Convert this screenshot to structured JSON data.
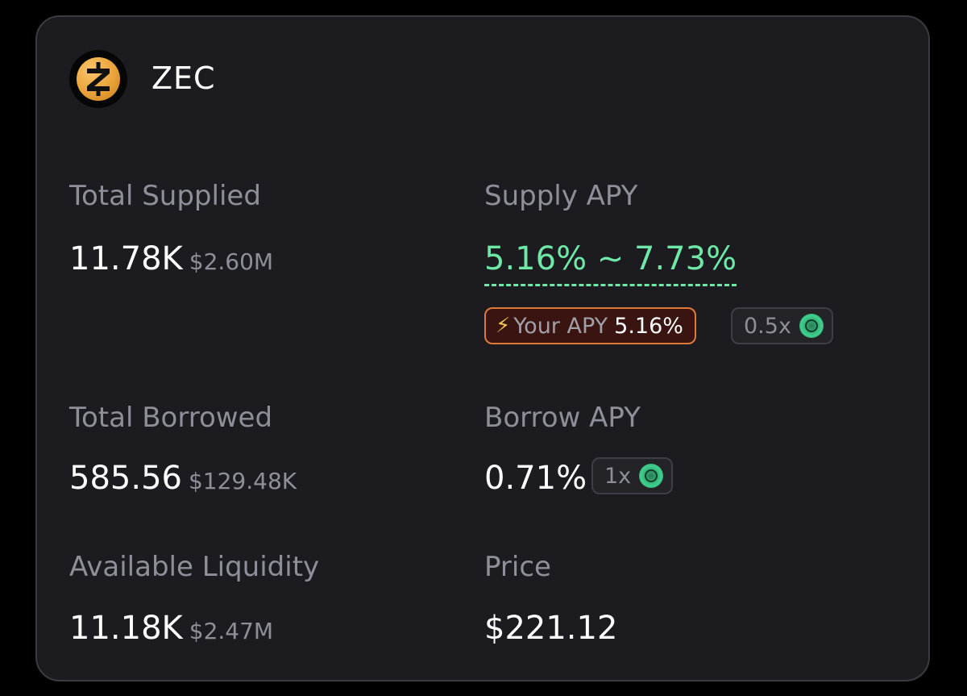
{
  "token": {
    "symbol": "ZEC",
    "logo_icon": "zcash-logo-icon"
  },
  "stats": {
    "total_supplied": {
      "label": "Total Supplied",
      "amount": "11.78K",
      "usd": "$2.60M"
    },
    "total_borrowed": {
      "label": "Total Borrowed",
      "amount": "585.56",
      "usd": "$129.48K"
    },
    "available_liquidity": {
      "label": "Available Liquidity",
      "amount": "11.18K",
      "usd": "$2.47M"
    }
  },
  "supply_apy": {
    "label": "Supply APY",
    "range": "5.16% ~ 7.73%",
    "your_apy_icon": "lightning-icon",
    "your_apy_label": "Your APY",
    "your_apy_value": "5.16%",
    "multiplier": "0.5x",
    "multiplier_icon": "reward-token-icon"
  },
  "borrow_apy": {
    "label": "Borrow APY",
    "value": "0.71%",
    "multiplier": "1x",
    "multiplier_icon": "reward-token-icon"
  },
  "price": {
    "label": "Price",
    "value": "$221.12"
  },
  "colors": {
    "background": "#000000",
    "card": "#1c1c20",
    "apy_green": "#6ee7a7",
    "your_apy_border": "#e07a3a",
    "muted_text": "#8e8f99"
  }
}
